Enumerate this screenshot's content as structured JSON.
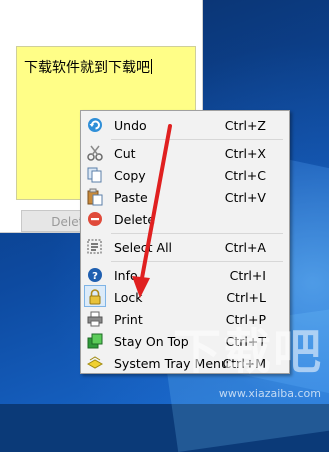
{
  "note": {
    "text": "下载软件就到下载吧",
    "delete_label": "Delete"
  },
  "menu": {
    "items": [
      {
        "label": "Undo",
        "shortcut": "Ctrl+Z",
        "icon": "undo-icon"
      },
      {
        "label": "Cut",
        "shortcut": "Ctrl+X",
        "icon": "scissors-icon"
      },
      {
        "label": "Copy",
        "shortcut": "Ctrl+C",
        "icon": "copy-icon"
      },
      {
        "label": "Paste",
        "shortcut": "Ctrl+V",
        "icon": "paste-icon"
      },
      {
        "label": "Delete",
        "shortcut": "",
        "icon": "delete-icon"
      },
      {
        "label": "Select All",
        "shortcut": "Ctrl+A",
        "icon": "select-all-icon"
      },
      {
        "label": "Info",
        "shortcut": "Ctrl+I",
        "icon": "info-icon"
      },
      {
        "label": "Lock",
        "shortcut": "Ctrl+L",
        "icon": "lock-icon"
      },
      {
        "label": "Print",
        "shortcut": "Ctrl+P",
        "icon": "printer-icon"
      },
      {
        "label": "Stay On Top",
        "shortcut": "Ctrl+T",
        "icon": "stay-on-top-icon"
      },
      {
        "label": "System Tray Menu",
        "shortcut": "Ctrl+M",
        "icon": "tray-icon"
      }
    ]
  },
  "watermark": {
    "logo_text": "下载吧",
    "url": "www.xiazaiba.com"
  },
  "colors": {
    "note_yellow": "#fffe87",
    "annotation_red": "#e02020",
    "desktop_blue": "#0d4aa0"
  }
}
